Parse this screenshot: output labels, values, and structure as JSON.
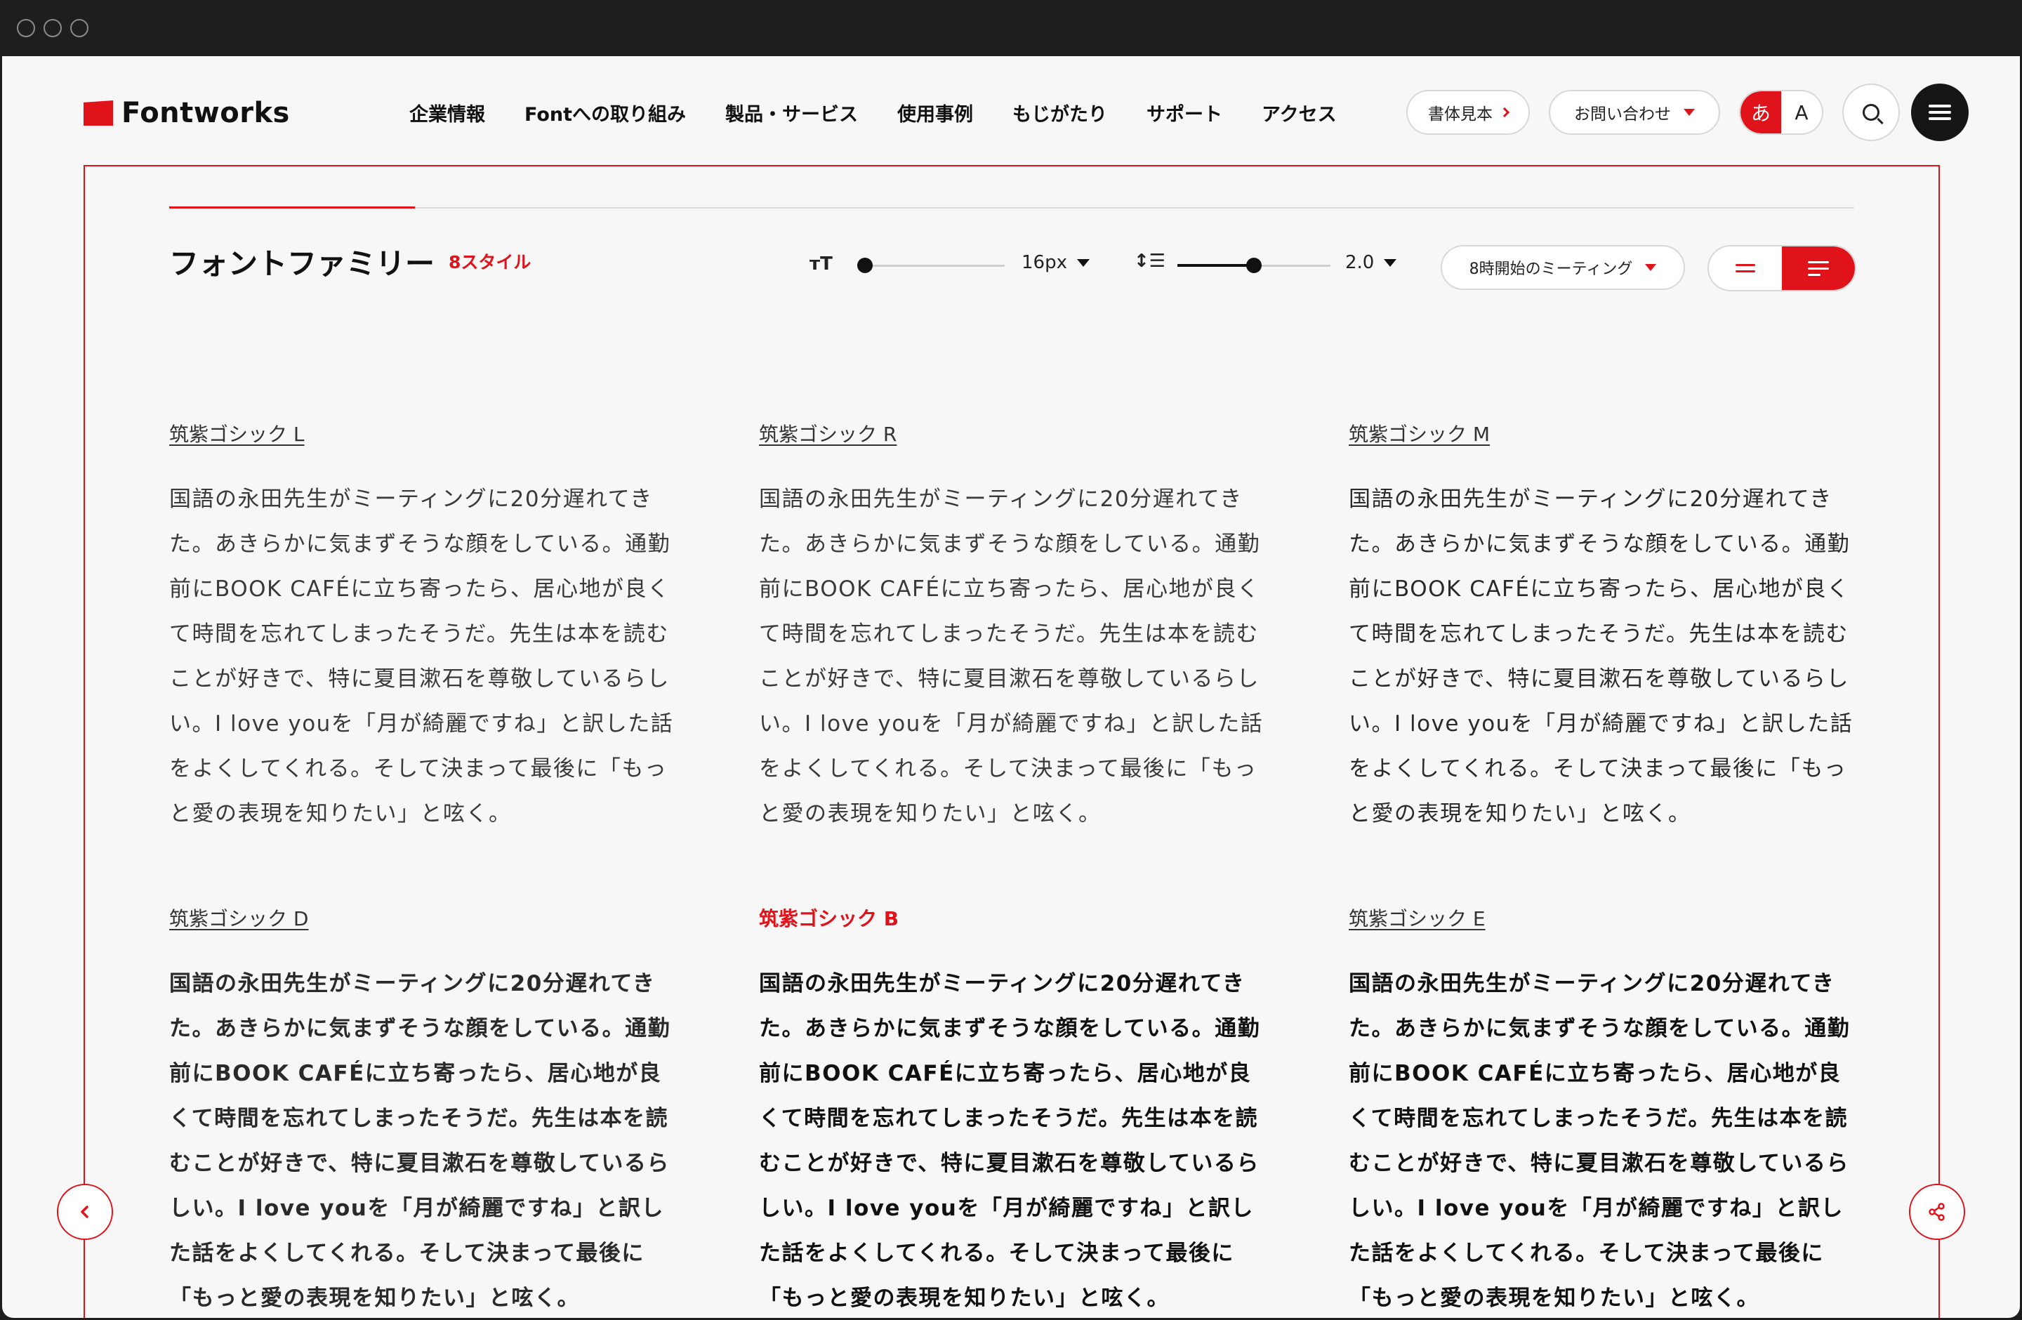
{
  "brand": {
    "name": "Fontworks",
    "accent_color": "#e0131b"
  },
  "nav": {
    "items": [
      "企業情報",
      "Fontへの取り組み",
      "製品・サービス",
      "使用事例",
      "もじがたり",
      "サポート",
      "アクセス"
    ]
  },
  "header": {
    "typeface_sample_label": "書体見本",
    "contact_label": "お問い合わせ",
    "lang_ja": "あ",
    "lang_en": "A",
    "search_icon": "search-icon",
    "menu_icon": "hamburger-menu-icon"
  },
  "family": {
    "title": "フォントファミリー",
    "style_count": "8スタイル",
    "font_size_icon": "font-size-icon",
    "font_size_value": "16px",
    "font_size_slider_level": 0.05,
    "line_height_icon": "line-height-icon",
    "line_height_value": "2.0",
    "line_height_slider_level": 0.5,
    "sample_text_select": "8時開始のミーティング",
    "align_options": [
      "align-center",
      "align-left"
    ],
    "align_selected": "align-left"
  },
  "samples": [
    {
      "name": "筑紫ゴシック L",
      "weight": 300,
      "active": false,
      "text": "国語の永田先生がミーティングに20分遅れてきた。あきらかに気まずそうな顔をしている。通勤前にBOOK CAFÉに立ち寄ったら、居心地が良くて時間を忘れてしまったそうだ。先生は本を読むことが好きで、特に夏目漱石を尊敬しているらしい。I love youを「月が綺麗ですね」と訳した話をよくしてくれる。そして決まって最後に「もっと愛の表現を知りたい」と呟く。"
    },
    {
      "name": "筑紫ゴシック R",
      "weight": 400,
      "active": false,
      "text": "国語の永田先生がミーティングに20分遅れてきた。あきらかに気まずそうな顔をしている。通勤前にBOOK CAFÉに立ち寄ったら、居心地が良くて時間を忘れてしまったそうだ。先生は本を読むことが好きで、特に夏目漱石を尊敬しているらしい。I love youを「月が綺麗ですね」と訳した話をよくしてくれる。そして決まって最後に「もっと愛の表現を知りたい」と呟く。"
    },
    {
      "name": "筑紫ゴシック M",
      "weight": 500,
      "active": false,
      "text": "国語の永田先生がミーティングに20分遅れてきた。あきらかに気まずそうな顔をしている。通勤前にBOOK CAFÉに立ち寄ったら、居心地が良くて時間を忘れてしまったそうだ。先生は本を読むことが好きで、特に夏目漱石を尊敬しているらしい。I love youを「月が綺麗ですね」と訳した話をよくしてくれる。そして決まって最後に「もっと愛の表現を知りたい」と呟く。"
    },
    {
      "name": "筑紫ゴシック D",
      "weight": 600,
      "active": false,
      "text": "国語の永田先生がミーティングに20分遅れてきた。あきらかに気まずそうな顔をしている。通勤前にBOOK CAFÉに立ち寄ったら、居心地が良くて時間を忘れてしまったそうだ。先生は本を読むことが好きで、特に夏目漱石を尊敬しているらしい。I love youを「月が綺麗ですね」と訳した話をよくしてくれる。そして決まって最後に「もっと愛の表現を知りたい」と呟く。"
    },
    {
      "name": "筑紫ゴシック B",
      "weight": 700,
      "active": true,
      "text": "国語の永田先生がミーティングに20分遅れてきた。あきらかに気まずそうな顔をしている。通勤前にBOOK CAFÉに立ち寄ったら、居心地が良くて時間を忘れてしまったそうだ。先生は本を読むことが好きで、特に夏目漱石を尊敬しているらしい。I love youを「月が綺麗ですね」と訳した話をよくしてくれる。そして決まって最後に「もっと愛の表現を知りたい」と呟く。"
    },
    {
      "name": "筑紫ゴシック E",
      "weight": 800,
      "active": false,
      "text": "国語の永田先生がミーティングに20分遅れてきた。あきらかに気まずそうな顔をしている。通勤前にBOOK CAFÉに立ち寄ったら、居心地が良くて時間を忘れてしまったそうだ。先生は本を読むことが好きで、特に夏目漱石を尊敬しているらしい。I love youを「月が綺麗ですね」と訳した話をよくしてくれる。そして決まって最後に「もっと愛の表現を知りたい」と呟く。"
    }
  ],
  "side": {
    "back_icon": "chevron-left-icon",
    "share_icon": "share-icon"
  }
}
